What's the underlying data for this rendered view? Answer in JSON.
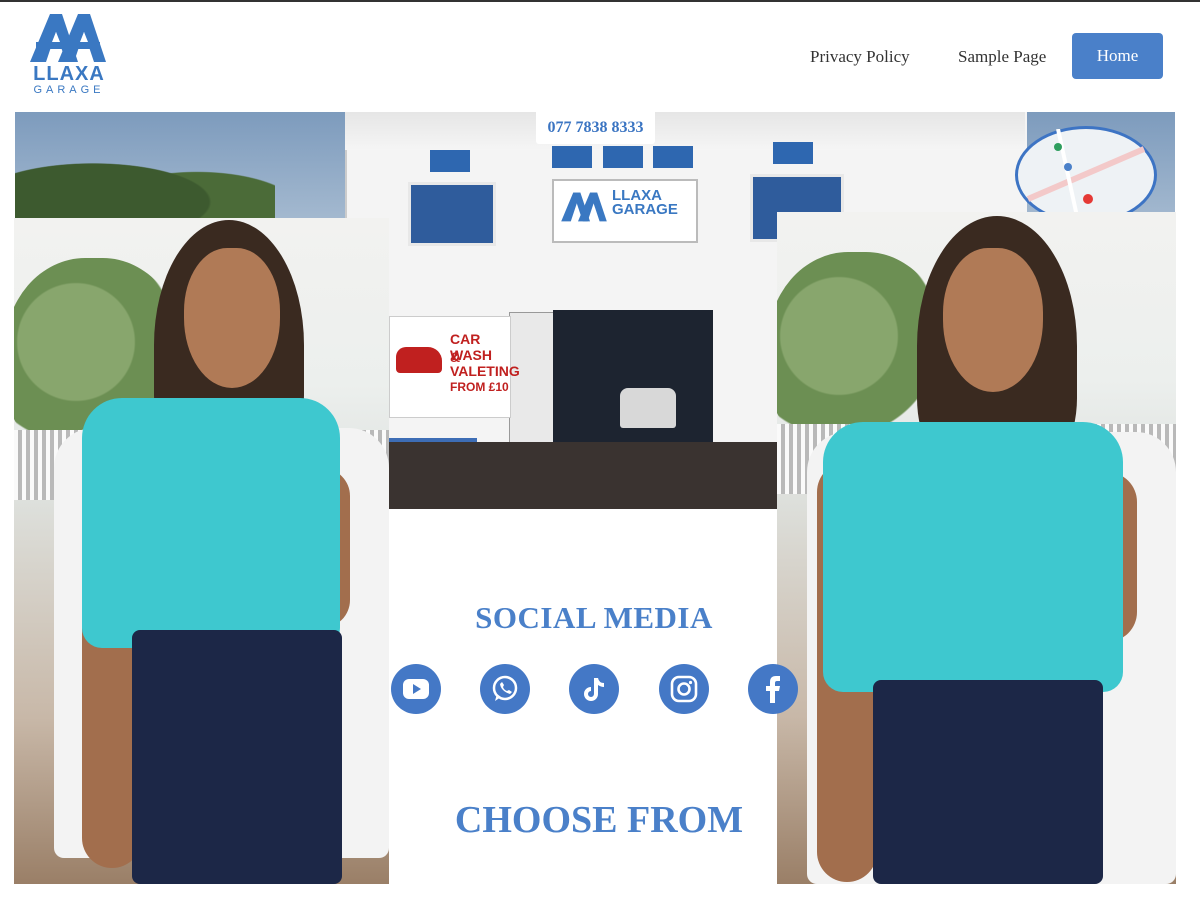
{
  "brand": {
    "name": "LLAXA",
    "sub": "GARAGE"
  },
  "nav": {
    "items": [
      {
        "label": "Privacy Policy"
      },
      {
        "label": "Sample Page"
      },
      {
        "label": "Home",
        "active": true
      }
    ]
  },
  "banner": {
    "phone": "077 7838 8333",
    "sign_name": "LLAXA GARAGE",
    "carwash_lines": [
      "CAR WASH",
      "&",
      "VALETING",
      "FROM £10"
    ]
  },
  "social": {
    "title": "SOCIAL MEDIA",
    "icons": [
      "youtube-icon",
      "whatsapp-icon",
      "tiktok-icon",
      "instagram-icon",
      "facebook-icon"
    ]
  },
  "choose": {
    "title": "CHOOSE FROM"
  },
  "colors": {
    "accent": "#4a80c9",
    "icon_bg": "#4478c6",
    "text": "#333333"
  }
}
